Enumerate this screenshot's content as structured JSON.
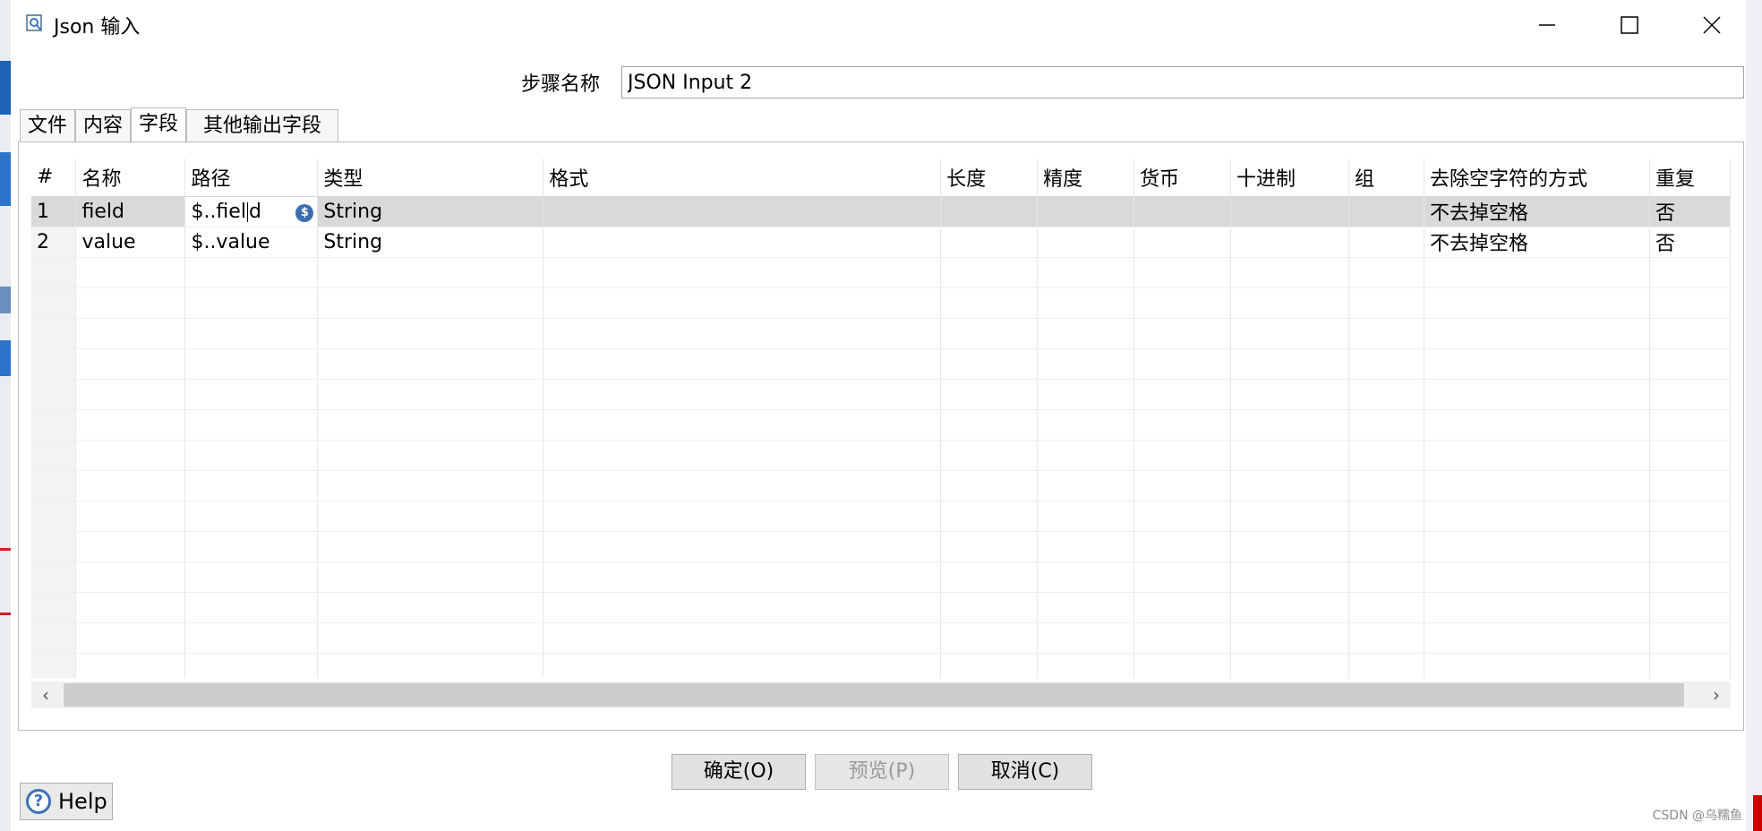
{
  "window": {
    "title": "Json 输入"
  },
  "step": {
    "label": "步骤名称",
    "value": "JSON Input 2"
  },
  "tabs": [
    {
      "label": "文件"
    },
    {
      "label": "内容"
    },
    {
      "label": "字段",
      "active": true
    },
    {
      "label": "其他输出字段"
    }
  ],
  "table": {
    "headers": [
      "#",
      "名称",
      "路径",
      "类型",
      "格式",
      "长度",
      "精度",
      "货币",
      "十进制",
      "组",
      "去除空字符的方式",
      "重复"
    ],
    "rows": [
      {
        "num": "1",
        "name": "field",
        "path_a": "$..fiel",
        "path_b": "d",
        "type": "String",
        "format": "",
        "length": "",
        "precision": "",
        "currency": "",
        "decimal": "",
        "group": "",
        "trim": "不去掉空格",
        "repeat": "否"
      },
      {
        "num": "2",
        "name": "value",
        "path": "$..value",
        "type": "String",
        "format": "",
        "length": "",
        "precision": "",
        "currency": "",
        "decimal": "",
        "group": "",
        "trim": "不去掉空格",
        "repeat": "否"
      }
    ]
  },
  "buttons": {
    "ok": "确定(O)",
    "preview": "预览(P)",
    "cancel": "取消(C)",
    "help": "Help"
  },
  "watermark": "CSDN @乌糯鱼",
  "icons": {
    "window": "json-input-icon",
    "badge": "dollar-icon"
  }
}
